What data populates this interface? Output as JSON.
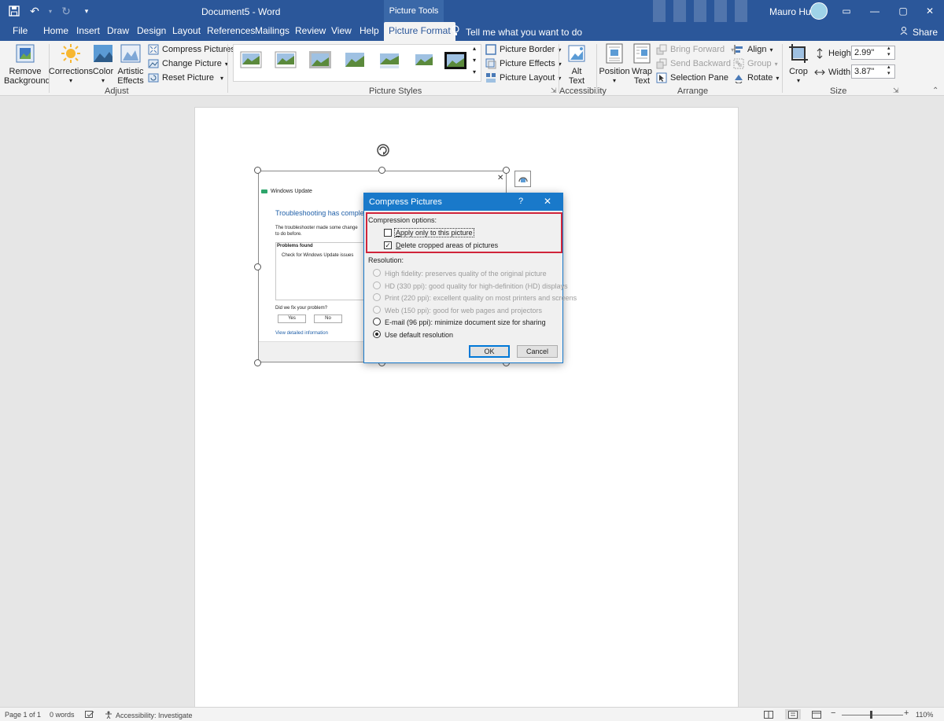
{
  "titlebar": {
    "doc_title": "Document5  -  Word",
    "contextual_tab": "Picture Tools",
    "user_name": "Mauro Huc"
  },
  "tabs": [
    "File",
    "Home",
    "Insert",
    "Draw",
    "Design",
    "Layout",
    "References",
    "Mailings",
    "Review",
    "View",
    "Help",
    "Picture Format"
  ],
  "active_tab": "Picture Format",
  "tell_me": "Tell me what you want to do",
  "share": "Share",
  "ribbon": {
    "adjust": {
      "remove_background": "Remove Background",
      "corrections": "Corrections",
      "color": "Color",
      "artistic_effects": "Artistic Effects",
      "compress_pictures": "Compress Pictures",
      "change_picture": "Change Picture",
      "reset_picture": "Reset Picture",
      "group_label": "Adjust"
    },
    "styles": {
      "picture_border": "Picture Border",
      "picture_effects": "Picture Effects",
      "picture_layout": "Picture Layout",
      "group_label": "Picture Styles"
    },
    "accessibility": {
      "alt_text": "Alt Text",
      "group_label": "Accessibility"
    },
    "arrange": {
      "position": "Position",
      "wrap_text": "Wrap Text",
      "bring_forward": "Bring Forward",
      "send_backward": "Send Backward",
      "selection_pane": "Selection Pane",
      "align": "Align",
      "group": "Group",
      "rotate": "Rotate",
      "group_label": "Arrange"
    },
    "size": {
      "crop": "Crop",
      "height_label": "Height:",
      "height_value": "2.99\"",
      "width_label": "Width:",
      "width_value": "3.87\"",
      "group_label": "Size"
    }
  },
  "picture": {
    "window_title": "Windows Update",
    "heading": "Troubleshooting has complete",
    "body_line1": "The troubleshooter made some change",
    "body_line2": "to do before.",
    "problems_header": "Problems found",
    "problem_item": "Check for Windows Update issues",
    "question": "Did we fix your problem?",
    "yes": "Yes",
    "no": "No",
    "link": "View detailed information"
  },
  "dialog": {
    "title": "Compress Pictures",
    "help": "?",
    "compression_label": "Compression options:",
    "apply_only": "Apply only to this picture",
    "apply_only_checked": false,
    "delete_cropped": "Delete cropped areas of pictures",
    "delete_cropped_checked": true,
    "resolution_label": "Resolution:",
    "options": [
      {
        "label": "High fidelity: preserves quality of the original picture",
        "enabled": false,
        "selected": false
      },
      {
        "label": "HD (330 ppi): good quality for high-definition (HD) displays",
        "enabled": false,
        "selected": false
      },
      {
        "label": "Print (220 ppi): excellent quality on most printers and screens",
        "enabled": false,
        "selected": false
      },
      {
        "label": "Web (150 ppi): good for web pages and projectors",
        "enabled": false,
        "selected": false
      },
      {
        "label": "E-mail (96 ppi): minimize document size for sharing",
        "enabled": true,
        "selected": false
      },
      {
        "label": "Use default resolution",
        "enabled": true,
        "selected": true
      }
    ],
    "ok": "OK",
    "cancel": "Cancel"
  },
  "statusbar": {
    "page": "Page 1 of 1",
    "words": "0 words",
    "accessibility": "Accessibility: Investigate",
    "zoom": "110%"
  },
  "colors": {
    "title_blue": "#2b579a",
    "dialog_blue": "#1979ca",
    "highlight_red": "#d0243a"
  }
}
